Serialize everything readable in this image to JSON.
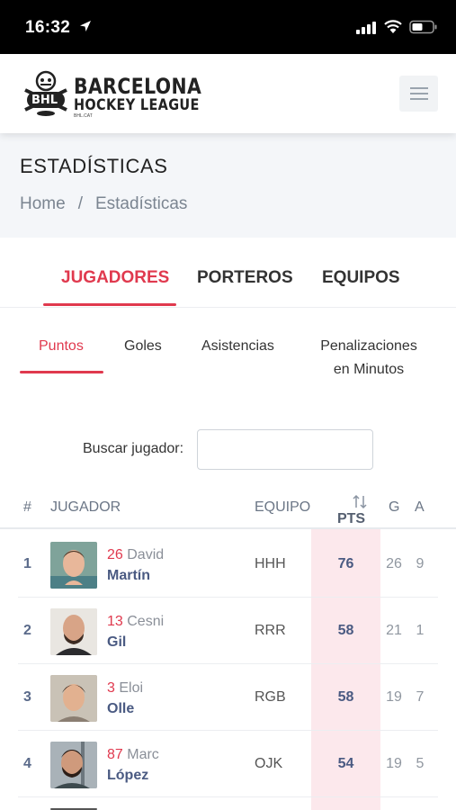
{
  "status_bar": {
    "time": "16:32"
  },
  "header": {
    "logo_badge": "BHL",
    "logo_line1": "BARCELONA",
    "logo_line2": "HOCKEY LEAGUE",
    "logo_small": "BHL.CAT",
    "menu_icon": "hamburger-menu-icon"
  },
  "hero": {
    "title": "ESTADÍSTICAS",
    "breadcrumb": {
      "home": "Home",
      "separator": "/",
      "current": "Estadísticas"
    }
  },
  "main_tabs": [
    {
      "label": "JUGADORES",
      "active": true
    },
    {
      "label": "PORTEROS",
      "active": false
    },
    {
      "label": "EQUIPOS",
      "active": false
    }
  ],
  "sub_tabs": [
    {
      "label": "Puntos",
      "active": true
    },
    {
      "label": "Goles",
      "active": false
    },
    {
      "label": "Asistencias",
      "active": false
    },
    {
      "label_line1": "Penalizaciones",
      "label_line2": "en Minutos",
      "active": false
    }
  ],
  "search": {
    "label": "Buscar jugador:",
    "value": ""
  },
  "table": {
    "headers": {
      "rank": "#",
      "player": "JUGADOR",
      "team": "EQUIPO",
      "pts": "PTS",
      "goals": "G",
      "assists": "A"
    },
    "rows": [
      {
        "rank": "1",
        "number": "26",
        "first_name": "David",
        "last_name": "Martín",
        "team": "HHH",
        "pts": "76",
        "goals": "26",
        "assists": "9"
      },
      {
        "rank": "2",
        "number": "13",
        "first_name": "Cesni",
        "last_name": "Gil",
        "team": "RRR",
        "pts": "58",
        "goals": "21",
        "assists": "1"
      },
      {
        "rank": "3",
        "number": "3",
        "first_name": "Eloi",
        "last_name": "Olle",
        "team": "RGB",
        "pts": "58",
        "goals": "19",
        "assists": "7"
      },
      {
        "rank": "4",
        "number": "87",
        "first_name": "Marc",
        "last_name": "López",
        "team": "OJK",
        "pts": "54",
        "goals": "19",
        "assists": "5"
      }
    ]
  },
  "colors": {
    "accent": "#e0394e",
    "pts_highlight": "#fce8ec",
    "player_name": "#4a5a82"
  }
}
